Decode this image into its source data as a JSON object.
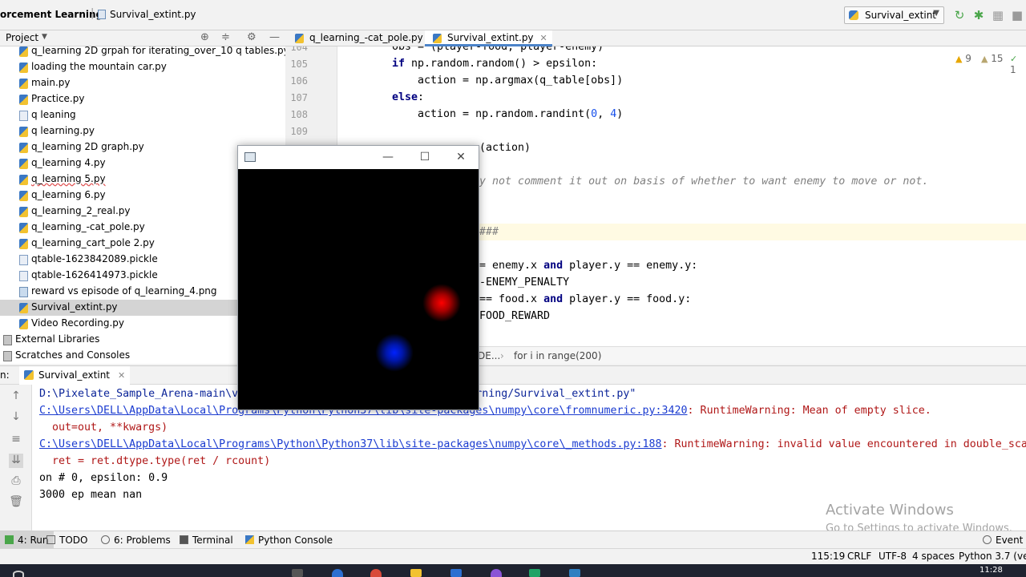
{
  "navbar": {
    "breadcrumb_project": "orcement Learning",
    "breadcrumb_file": "Survival_extint.py",
    "run_config": "Survival_extint"
  },
  "project_panel": {
    "title": "Project",
    "items": [
      {
        "label": "q_learning 2D grpah for iterating_over_10 q tables.py",
        "type": "py"
      },
      {
        "label": "loading the mountain car.py",
        "type": "py"
      },
      {
        "label": "main.py",
        "type": "py"
      },
      {
        "label": "Practice.py",
        "type": "py"
      },
      {
        "label": "q leaning",
        "type": "file"
      },
      {
        "label": "q learning.py",
        "type": "py"
      },
      {
        "label": "q_learning 2D graph.py",
        "type": "py"
      },
      {
        "label": "q_learning 4.py",
        "type": "py"
      },
      {
        "label": "q_learning 5.py",
        "type": "py"
      },
      {
        "label": "q_learning 6.py",
        "type": "py"
      },
      {
        "label": "q_learning_2_real.py",
        "type": "py"
      },
      {
        "label": "q_learning_-cat_pole.py",
        "type": "py"
      },
      {
        "label": "q_learning_cart_pole 2.py",
        "type": "py"
      },
      {
        "label": "qtable-1623842089.pickle",
        "type": "file"
      },
      {
        "label": "qtable-1626414973.pickle",
        "type": "file"
      },
      {
        "label": "reward vs episode of q_learning_4.png",
        "type": "png"
      },
      {
        "label": "Survival_extint.py",
        "type": "py"
      },
      {
        "label": "Video Recording.py",
        "type": "py"
      }
    ],
    "external_libraries": "External Libraries",
    "scratches": "Scratches and Consoles"
  },
  "editor": {
    "tabs": [
      "q_learning_-cat_pole.py",
      "Survival_extint.py"
    ],
    "line_numbers": [
      "104",
      "105",
      "106",
      "107",
      "108",
      "109"
    ],
    "code": {
      "l104": "obs = (player-food, player-enemy)",
      "l105_kw": "if",
      "l105_rest": " np.random.random() > epsilon:",
      "l106": "    action = np.argmax(q_table[obs])",
      "l107_kw": "else",
      "l108_a": "    action = np.random.randint(",
      "l108_n1": "0",
      "l108_b": ", ",
      "l108_n2": "4",
      "l108_c": ")",
      "l110": "(action)",
      "l111": "y not comment it out on basis of whether to want enemy to move or not.",
      "l114": "###",
      "l116_a": "= enemy.x ",
      "l116_kw": "and",
      "l116_b": " player.y == enemy.y:",
      "l117": "-ENEMY_PENALTY",
      "l118_a": "== food.x ",
      "l118_kw": "and",
      "l118_b": " player.y == food.y:",
      "l119": "FOOD_REWARD"
    },
    "inspections": {
      "warnings": "9",
      "weak": "15",
      "other": "1"
    },
    "breadcrumb_left": "DE...",
    "breadcrumb_right": "for i in range(200)"
  },
  "run_panel": {
    "label": "n:",
    "tab": "Survival_extint",
    "lines": {
      "l1": "D:\\Pixelate_Sample_Arena-main\\v",
      "l1_tail": "ent Learning/Survival_extint.py\"",
      "l2_link": "C:\\Users\\DELL\\AppData\\Local\\Programs\\Python\\Python37\\lib\\site-packages\\numpy\\core\\fromnumeric.py:3420",
      "l2_msg": ": RuntimeWarning: Mean of empty slice.",
      "l3": "  out=out, **kwargs)",
      "l4_link": "C:\\Users\\DELL\\AppData\\Local\\Programs\\Python\\Python37\\lib\\site-packages\\numpy\\core\\_methods.py:188",
      "l4_msg": ": RuntimeWarning: invalid value encountered in double_sca",
      "l5": "  ret = ret.dtype.type(ret / rcount)",
      "l6": "on # 0, epsilon: 0.9",
      "l7": "3000 ep mean nan"
    },
    "watermark_title": "Activate Windows",
    "watermark_sub": "Go to Settings to activate Windows."
  },
  "tool_tabs": {
    "run": "4: Run",
    "todo": "TODO",
    "problems": "6: Problems",
    "terminal": "Terminal",
    "python_console": "Python Console",
    "event_log": "Event L"
  },
  "status_bar": {
    "position": "115:19",
    "line_sep": "CRLF",
    "encoding": "UTF-8",
    "indent": "4 spaces",
    "interpreter": "Python 3.7 (ven"
  },
  "taskbar": {
    "time": "11:28"
  },
  "colors": {
    "accent": "#4b83c9",
    "enemy_blob": "#ff0000",
    "player_blob": "#0022ff"
  }
}
